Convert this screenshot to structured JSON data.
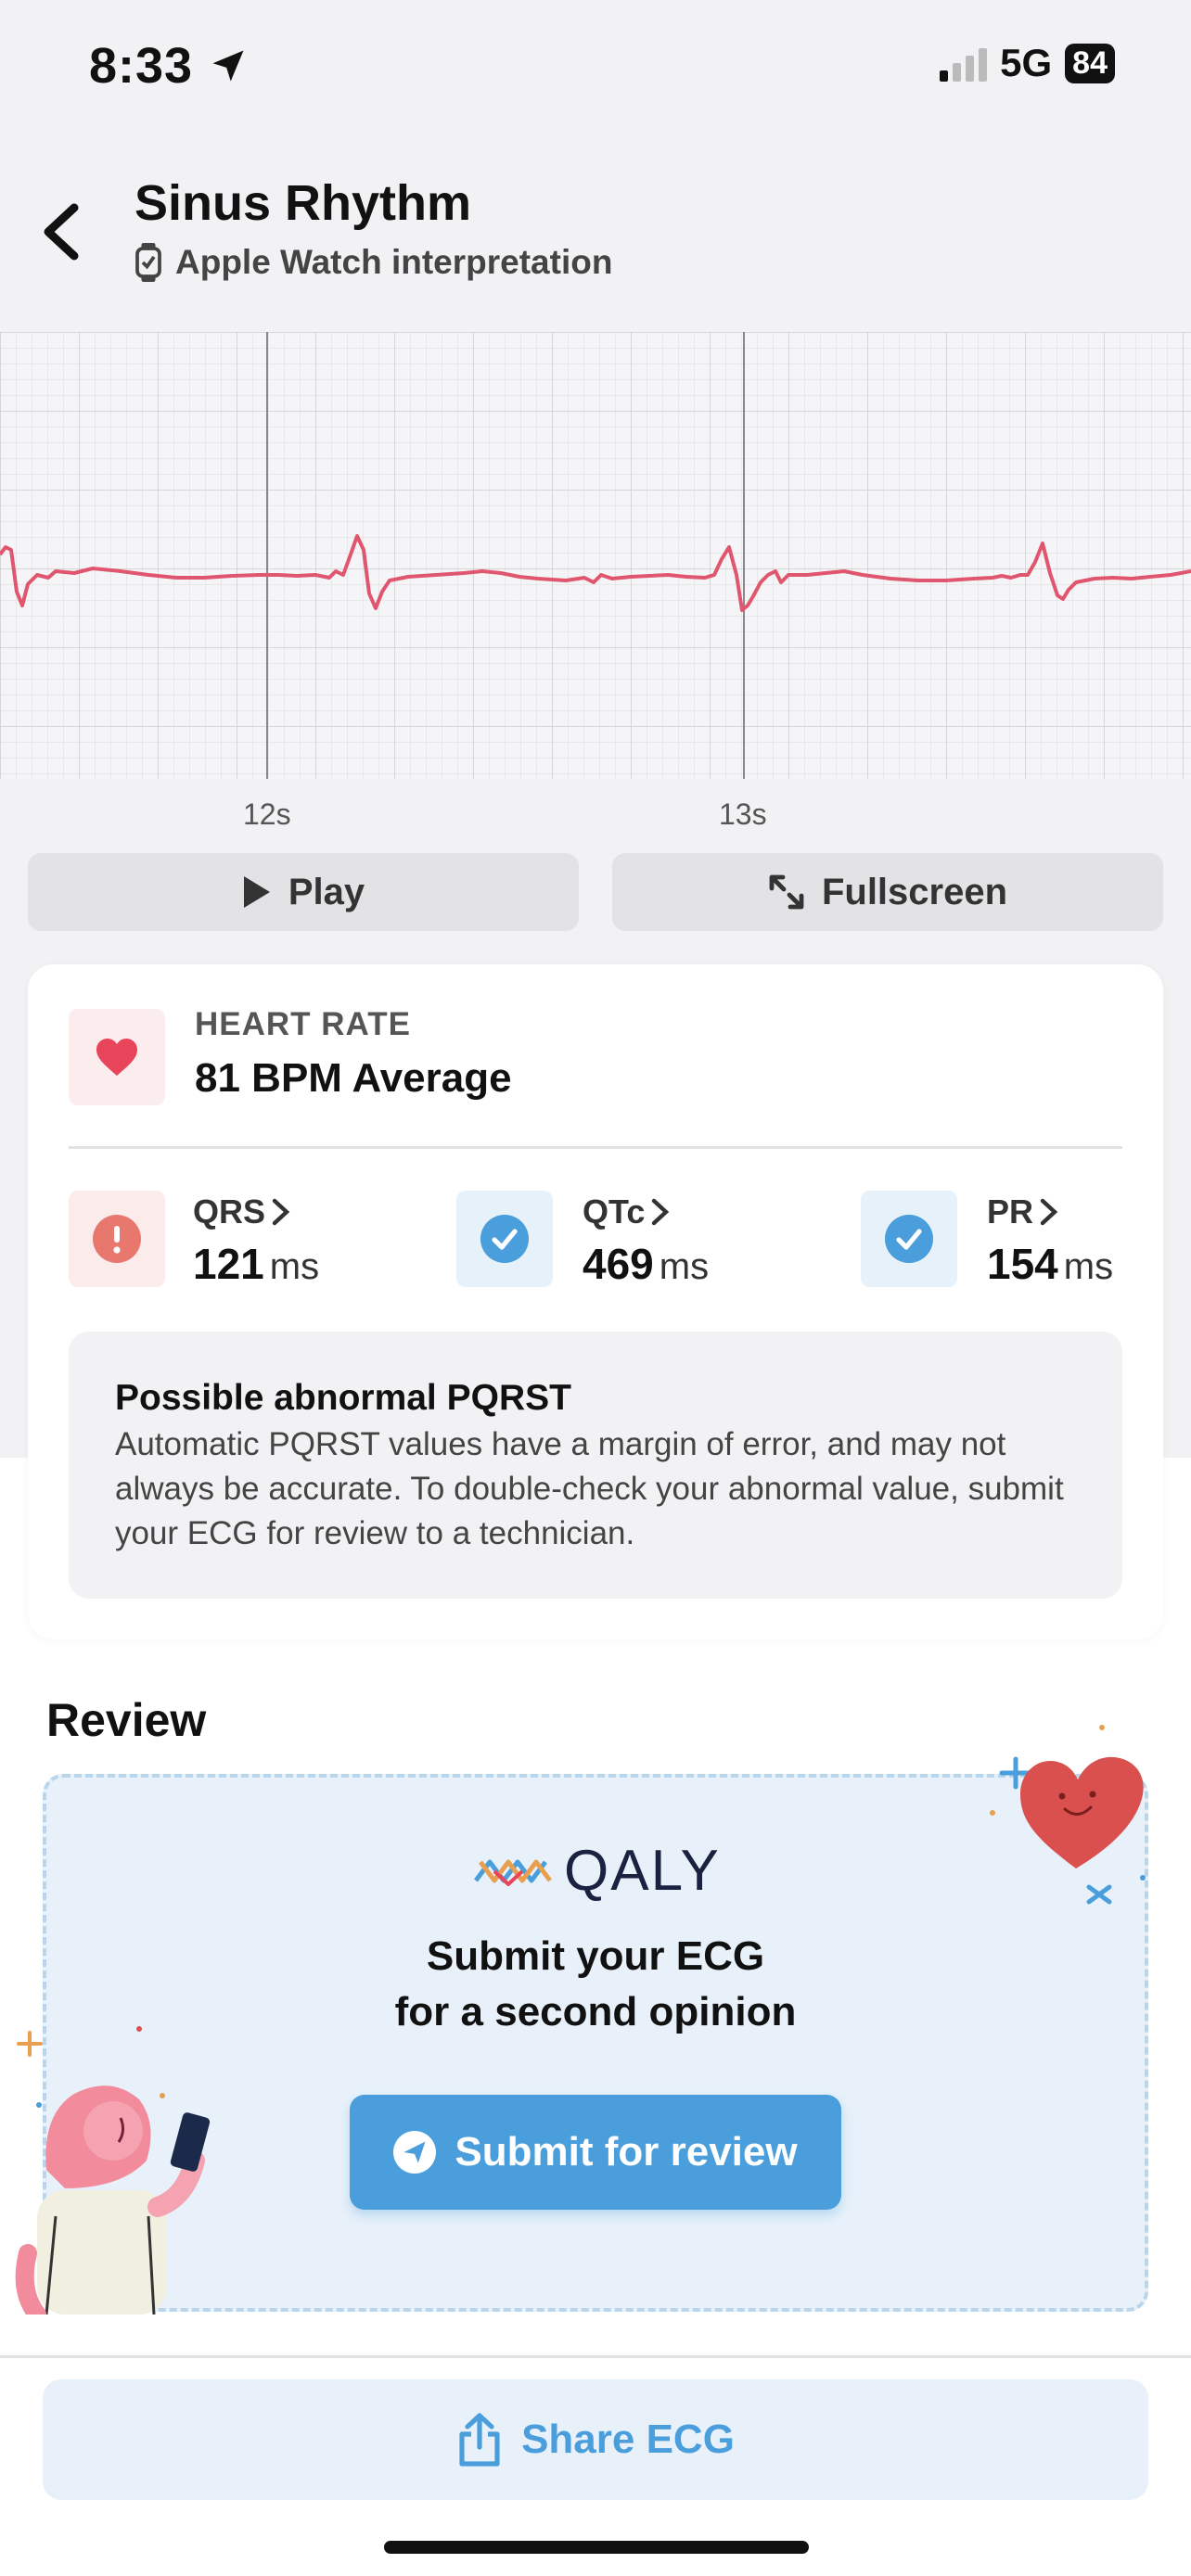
{
  "status_bar": {
    "time": "8:33",
    "network": "5G",
    "battery": "84"
  },
  "header": {
    "title": "Sinus Rhythm",
    "subtitle": "Apple Watch interpretation"
  },
  "ecg": {
    "tick_labels": [
      "12s",
      "13s"
    ],
    "trace_color": "#e0566e"
  },
  "controls": {
    "play_label": "Play",
    "fullscreen_label": "Fullscreen"
  },
  "heart_rate": {
    "label": "HEART RATE",
    "value": "81 BPM Average"
  },
  "metrics": [
    {
      "name": "QRS",
      "value": "121",
      "unit": "ms",
      "status": "abnormal"
    },
    {
      "name": "QTc",
      "value": "469",
      "unit": "ms",
      "status": "normal"
    },
    {
      "name": "PR",
      "value": "154",
      "unit": "ms",
      "status": "normal"
    }
  ],
  "notice": {
    "title": "Possible abnormal PQRST",
    "body": "Automatic PQRST values have a margin of error, and may not always be accurate. To double-check your abnormal value, submit your ECG for review to a technician."
  },
  "review": {
    "section_title": "Review",
    "brand": "QALY",
    "line1": "Submit your ECG",
    "line2": "for a second opinion",
    "submit_label": "Submit for review"
  },
  "share": {
    "label": "Share ECG"
  },
  "colors": {
    "accent": "#4a9edb",
    "alert": "#e8786e",
    "heart": "#e8445a"
  }
}
